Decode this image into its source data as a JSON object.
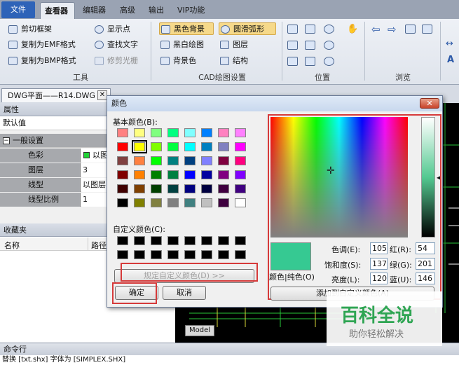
{
  "tabs": [
    {
      "label": "文件"
    },
    {
      "label": "查看器"
    },
    {
      "label": "编辑器"
    },
    {
      "label": "高级"
    },
    {
      "label": "输出"
    },
    {
      "label": "VIP功能"
    }
  ],
  "ribbon": {
    "tools": {
      "title": "工具",
      "items": [
        "剪切框架",
        "复制为EMF格式",
        "复制为BMP格式",
        "显示点",
        "查找文字",
        "修剪光栅"
      ]
    },
    "cad": {
      "title": "CAD绘图设置",
      "items": [
        "黑色背景",
        "黑白绘图",
        "背景色",
        "圆滑弧形",
        "图层",
        "结构"
      ]
    },
    "position": {
      "title": "位置"
    },
    "browse": {
      "title": "浏览"
    }
  },
  "doc_tab": {
    "label": "DWG平面——R14.DWG",
    "close": "✕"
  },
  "properties": {
    "title": "属性",
    "default": "默认值",
    "group": "一般设置",
    "rows": [
      {
        "key": "色彩",
        "value": "以图"
      },
      {
        "key": "图层",
        "value": "3"
      },
      {
        "key": "线型",
        "value": "以图层"
      },
      {
        "key": "线型比例",
        "value": "1"
      }
    ]
  },
  "favorites": {
    "title": "收藏夹",
    "col_name": "名称",
    "col_path": "路径"
  },
  "model_tab": "Model",
  "command": {
    "title": "命令行",
    "text": "替换 [txt.shx] 字体为 [SIMPLEX.SHX]"
  },
  "color_dialog": {
    "title": "颜色",
    "close": "✕",
    "basic_label": "基本颜色(B):",
    "custom_label": "自定义颜色(C):",
    "define_custom": "规定自定义颜色(D) >>",
    "ok": "确定",
    "cancel": "取消",
    "solid_label": "颜色|纯色(O)",
    "add_custom": "添加到自定义颜色(A)",
    "hue_label": "色调(E):",
    "hue": "105",
    "sat_label": "饱和度(S):",
    "sat": "137",
    "lum_label": "亮度(L):",
    "lum": "120",
    "red_label": "红(R):",
    "red": "54",
    "green_label": "绿(G):",
    "green": "201",
    "blue_label": "蓝(U):",
    "blue": "146",
    "basic_colors": [
      "#ff8080",
      "#ffff80",
      "#80ff80",
      "#00ff80",
      "#80ffff",
      "#0080ff",
      "#ff80c0",
      "#ff80ff",
      "#ff0000",
      "#ffff00",
      "#80ff00",
      "#00ff40",
      "#00ffff",
      "#0080c0",
      "#8080c0",
      "#ff00ff",
      "#804040",
      "#ff8040",
      "#00ff00",
      "#008080",
      "#004080",
      "#8080ff",
      "#800040",
      "#ff0080",
      "#800000",
      "#ff8000",
      "#008000",
      "#008040",
      "#0000ff",
      "#0000a0",
      "#800080",
      "#8000ff",
      "#400000",
      "#804000",
      "#004000",
      "#004040",
      "#000080",
      "#000040",
      "#400040",
      "#400080",
      "#000000",
      "#808000",
      "#808040",
      "#808080",
      "#408080",
      "#c0c0c0",
      "#400040",
      "#ffffff"
    ]
  },
  "watermark": {
    "title": "百科全说",
    "subtitle": "助你轻松解决"
  }
}
